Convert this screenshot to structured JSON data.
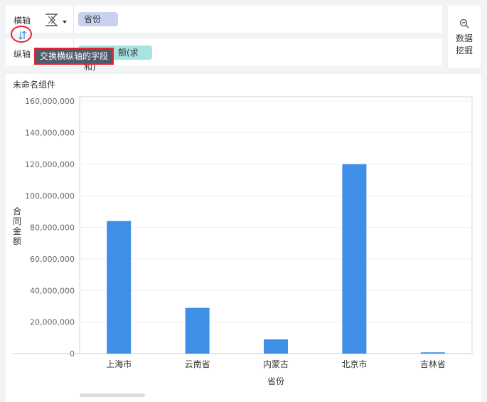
{
  "axis_panel": {
    "x_axis_label": "横轴",
    "y_axis_label": "纵轴",
    "x_field": "省份",
    "y_field_visible": "额(求和)",
    "tooltip": "交换横纵轴的字段"
  },
  "data_mining": {
    "line1": "数据",
    "line2": "挖掘"
  },
  "component": {
    "title": "未命名组件"
  },
  "colors": {
    "bar": "#3f8ee8",
    "tooltip_border": "#e8242f",
    "x_pill": "#c8d2f0",
    "y_pill": "#a7e3e1"
  },
  "icons": {
    "chart_type": "chart-type-icon",
    "swap": "swap-axis-icon",
    "mining": "data-mining-icon"
  },
  "chart_data": {
    "type": "bar",
    "categories": [
      "上海市",
      "云南省",
      "内蒙古",
      "北京市",
      "吉林省"
    ],
    "values": [
      84000000,
      29000000,
      9000000,
      120000000,
      800000
    ],
    "xlabel": "省份",
    "ylabel": "合同金额",
    "ylim": [
      0,
      160000000
    ],
    "yticks": [
      "0",
      "20,000,000",
      "40,000,000",
      "60,000,000",
      "80,000,000",
      "100,000,000",
      "120,000,000",
      "140,000,000",
      "160,000,000"
    ],
    "grid": true
  }
}
